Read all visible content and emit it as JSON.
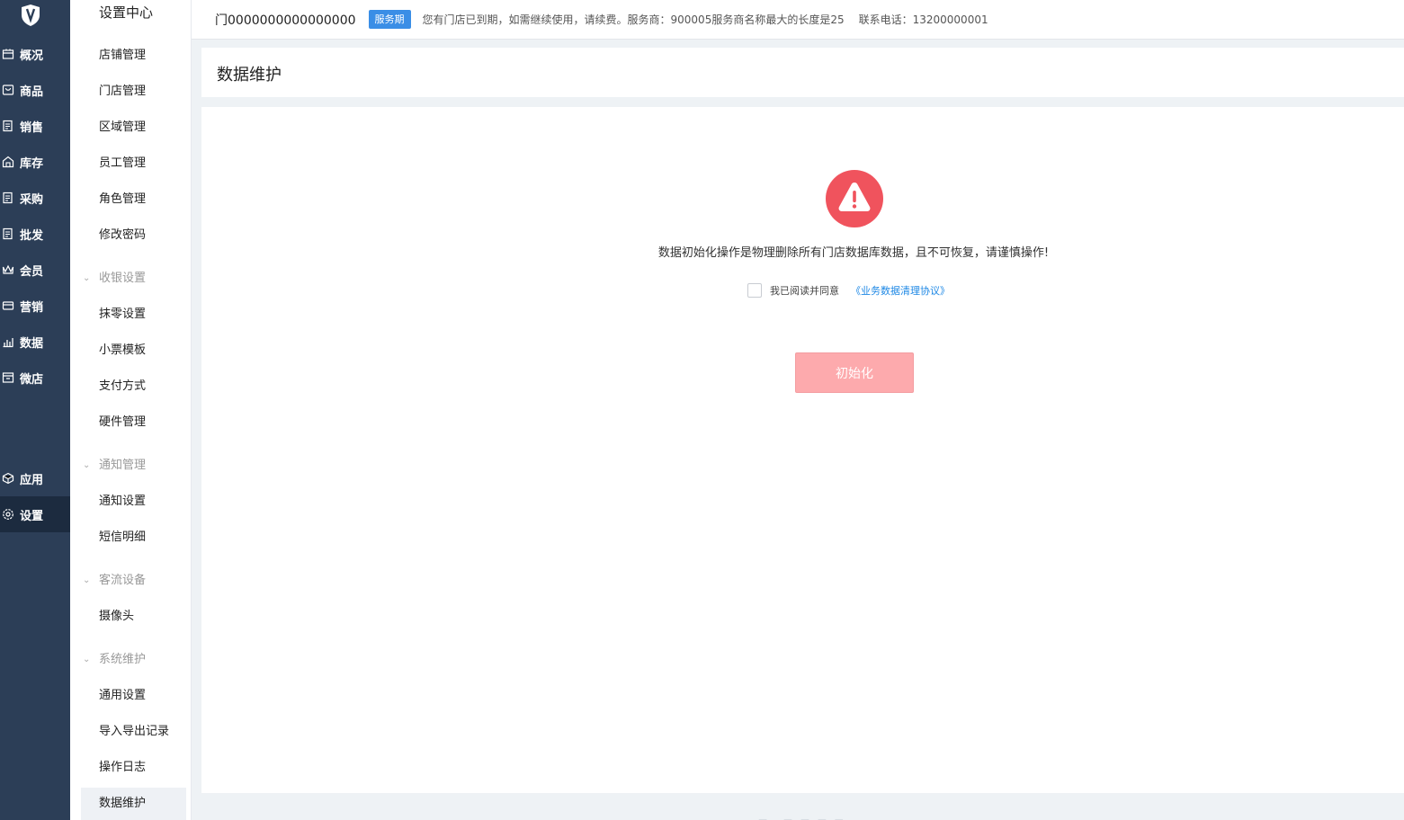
{
  "nav_primary": [
    {
      "label": "概况",
      "icon": "overview-icon"
    },
    {
      "label": "商品",
      "icon": "goods-icon"
    },
    {
      "label": "销售",
      "icon": "sales-icon"
    },
    {
      "label": "库存",
      "icon": "inventory-icon"
    },
    {
      "label": "采购",
      "icon": "purchase-icon"
    },
    {
      "label": "批发",
      "icon": "wholesale-icon"
    },
    {
      "label": "会员",
      "icon": "member-icon"
    },
    {
      "label": "营销",
      "icon": "marketing-icon"
    },
    {
      "label": "数据",
      "icon": "data-icon"
    },
    {
      "label": "微店",
      "icon": "microstore-icon"
    },
    {
      "label": "应用",
      "icon": "apps-icon"
    },
    {
      "label": "设置",
      "icon": "settings-icon",
      "active": true
    }
  ],
  "nav_secondary": {
    "title": "设置中心",
    "items": [
      "店铺管理",
      "门店管理",
      "区域管理",
      "员工管理",
      "角色管理",
      "修改密码",
      "收银设置",
      "抹零设置",
      "小票模板",
      "支付方式",
      "硬件管理",
      "通知管理",
      "通知设置",
      "短信明细",
      "客流设备",
      "摄像头",
      "系统维护",
      "通用设置",
      "导入导出记录",
      "操作日志",
      "数据维护"
    ]
  },
  "topbar": {
    "store_name": "门0000000000000000",
    "badge": "服务期",
    "notice": "您有门店已到期，如需继续使用，请续费。服务商：900005服务商名称最大的长度是25",
    "phone": "联系电话：13200000001"
  },
  "page": {
    "title": "数据维护",
    "warning": "数据初始化操作是物理删除所有门店数据库数据，且不可恢复，请谨慎操作!",
    "agree_label": "我已阅读并同意",
    "agree_link": "《业务数据清理协议》",
    "init_button": "初始化"
  },
  "colors": {
    "nav_bg": "#2c3e57",
    "nav_active": "#1c2b3f",
    "badge": "#3a8ee6",
    "warning": "#f0535d",
    "button_disabled": "#fdaaad",
    "link": "#1e88e5"
  }
}
